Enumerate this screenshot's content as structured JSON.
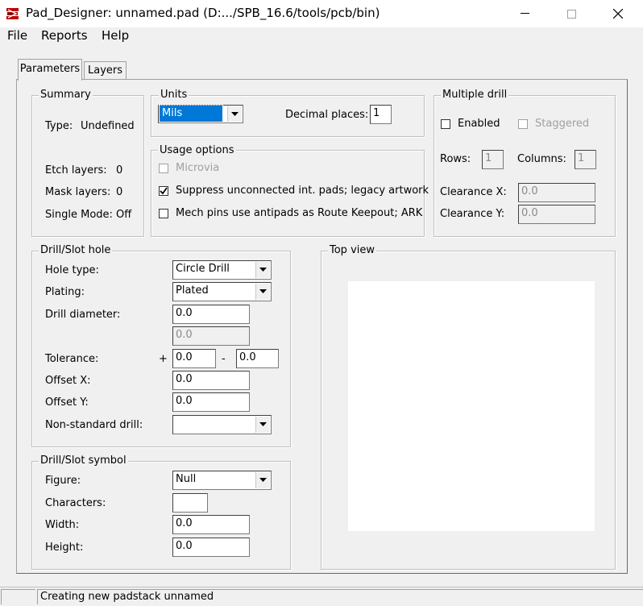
{
  "window": {
    "title": "Pad_Designer: unnamed.pad (D:.../SPB_16.6/tools/pcb/bin)",
    "minimize": "—",
    "maximize": "☐",
    "close": "✕"
  },
  "menu": [
    "File",
    "Reports",
    "Help"
  ],
  "tabs": [
    "Parameters",
    "Layers"
  ],
  "summary": {
    "legend": "Summary",
    "type_label": "Type:",
    "type_value": "Undefined",
    "etch_label": "Etch layers:",
    "etch_value": "0",
    "mask_label": "Mask layers:",
    "mask_value": "0",
    "single_label": "Single Mode:",
    "single_value": "Off"
  },
  "units": {
    "legend": "Units",
    "selected": "Mils",
    "decimal_label": "Decimal places:",
    "decimal_value": "1"
  },
  "usage": {
    "legend": "Usage options",
    "microvia": "Microvia",
    "suppress": "Suppress unconnected int. pads; legacy artwork",
    "mech": "Mech pins use antipads as Route Keepout; ARK"
  },
  "multi_drill": {
    "legend": "Multiple drill",
    "enabled": "Enabled",
    "staggered": "Staggered",
    "rows_label": "Rows:",
    "rows_value": "1",
    "cols_label": "Columns:",
    "cols_value": "1",
    "clearance_x_label": "Clearance X:",
    "clearance_x_value": "0.0",
    "clearance_y_label": "Clearance Y:",
    "clearance_y_value": "0.0"
  },
  "drill": {
    "legend": "Drill/Slot hole",
    "hole_type_label": "Hole type:",
    "hole_type_value": "Circle Drill",
    "plating_label": "Plating:",
    "plating_value": "Plated",
    "diameter_label": "Drill diameter:",
    "diameter_value": "0.0",
    "diameter2_value": "0.0",
    "tolerance_label": "Tolerance:",
    "tol_plus": "+",
    "tol_plus_value": "0.0",
    "tol_minus": "-",
    "tol_minus_value": "0.0",
    "offx_label": "Offset X:",
    "offx_value": "0.0",
    "offy_label": "Offset Y:",
    "offy_value": "0.0",
    "nonstd_label": "Non-standard drill:",
    "nonstd_value": ""
  },
  "symbol": {
    "legend": "Drill/Slot symbol",
    "figure_label": "Figure:",
    "figure_value": "Null",
    "chars_label": "Characters:",
    "chars_value": "",
    "width_label": "Width:",
    "width_value": "0.0",
    "height_label": "Height:",
    "height_value": "0.0"
  },
  "topview": {
    "legend": "Top view"
  },
  "status": {
    "message": "Creating new padstack unnamed"
  },
  "colors": {
    "selection": "#0078d7",
    "background": "#f0f0f0"
  }
}
